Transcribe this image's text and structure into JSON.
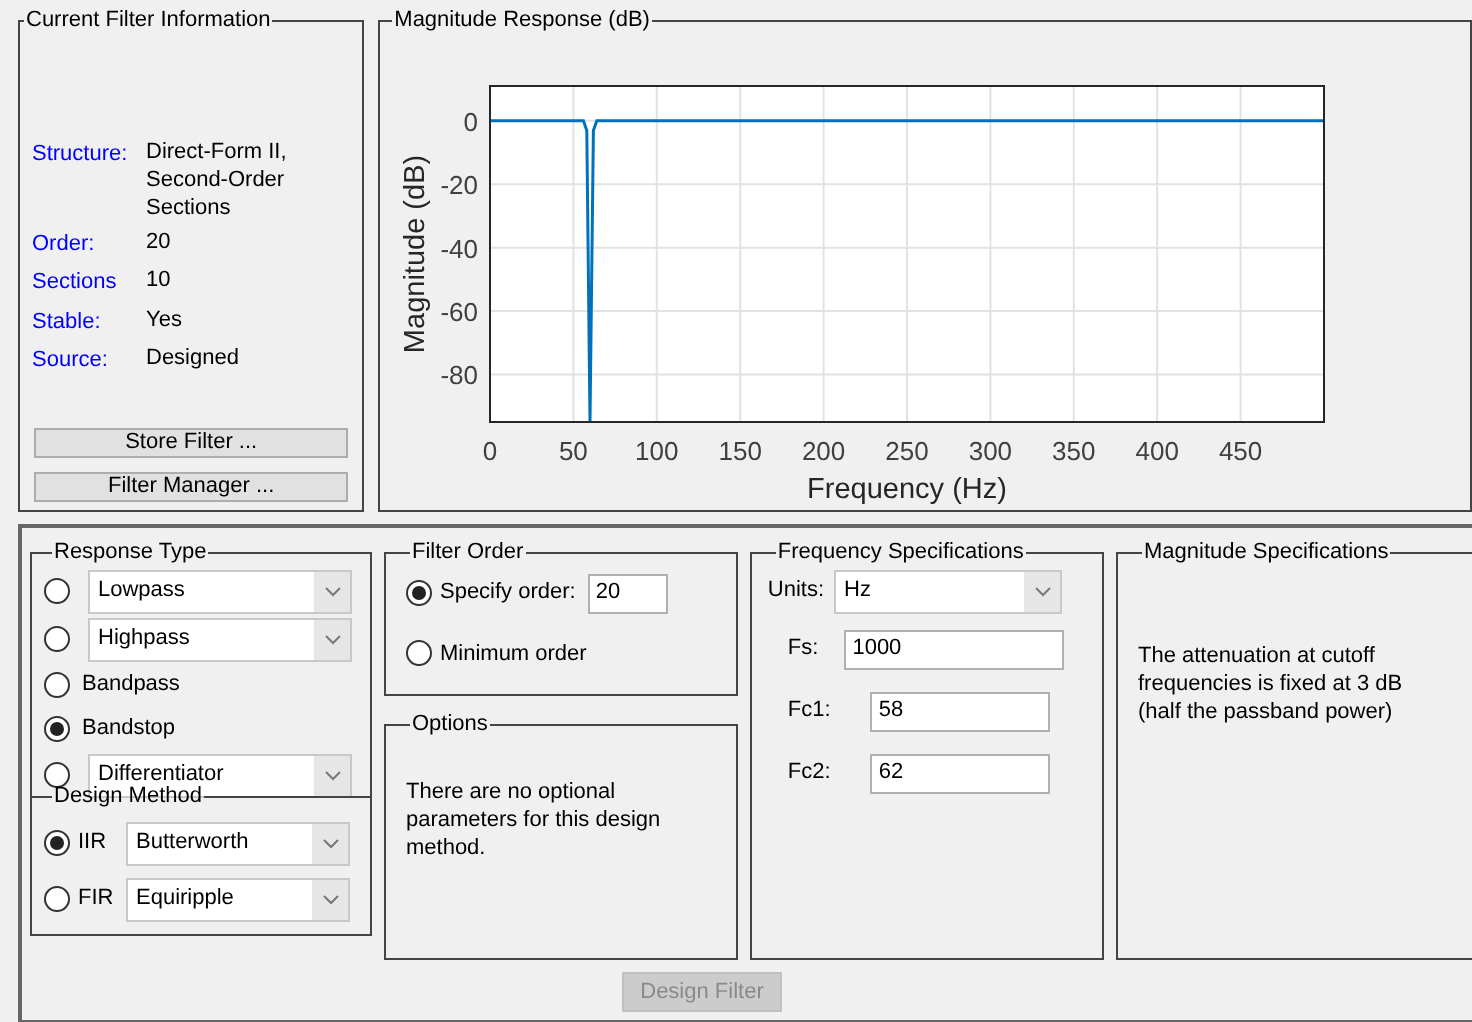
{
  "filter_info": {
    "title": "Current Filter Information",
    "rows": [
      {
        "label": "Structure:",
        "value": "Direct-Form II, Second-Order Sections"
      },
      {
        "label": "Order:",
        "value": "20"
      },
      {
        "label": "Sections",
        "value": "10"
      },
      {
        "label": "Stable:",
        "value": "Yes"
      },
      {
        "label": "Source:",
        "value": "Designed"
      }
    ],
    "buttons": [
      "Store Filter ...",
      "Filter Manager ..."
    ]
  },
  "magnitude_response": {
    "title": "Magnitude Response (dB)",
    "chart_data": {
      "type": "line",
      "xlabel": "Frequency (Hz)",
      "ylabel": "Magnitude (dB)",
      "x": [
        0,
        56,
        58,
        60,
        62,
        64,
        500
      ],
      "series": [
        {
          "color": "#0072bd",
          "values": [
            0,
            0,
            -3,
            -95,
            -3,
            0,
            0
          ]
        }
      ],
      "grid": true,
      "xlim": [
        0,
        500
      ],
      "ylim": [
        -95,
        11
      ],
      "xticks": [
        0,
        50,
        100,
        150,
        200,
        250,
        300,
        350,
        400,
        450
      ],
      "yticks": [
        -80,
        -60,
        -40,
        -20,
        0
      ]
    }
  },
  "response_type": {
    "title": "Response Type",
    "options": [
      {
        "kind": "dropdown",
        "label": "Lowpass",
        "selected": false
      },
      {
        "kind": "dropdown",
        "label": "Highpass",
        "selected": false
      },
      {
        "kind": "radio",
        "label": "Bandpass",
        "selected": false
      },
      {
        "kind": "radio",
        "label": "Bandstop",
        "selected": true
      },
      {
        "kind": "dropdown",
        "label": "Differentiator",
        "selected": false
      }
    ]
  },
  "design_method": {
    "title": "Design Method",
    "options": [
      {
        "label": "IIR",
        "value": "Butterworth",
        "selected": true
      },
      {
        "label": "FIR",
        "value": "Equiripple",
        "selected": false
      }
    ]
  },
  "filter_order": {
    "title": "Filter Order",
    "options": [
      {
        "label": "Specify order:",
        "value": "20",
        "selected": true
      },
      {
        "label": "Minimum order",
        "selected": false
      }
    ]
  },
  "options": {
    "title": "Options",
    "text": "There are no optional parameters for this design method."
  },
  "frequency_specifications": {
    "title": "Frequency Specifications",
    "units": {
      "label": "Units:",
      "value": "Hz"
    },
    "fields": [
      {
        "label": "Fs:",
        "value": "1000"
      },
      {
        "label": "Fc1:",
        "value": "58"
      },
      {
        "label": "Fc2:",
        "value": "62"
      }
    ]
  },
  "magnitude_specifications": {
    "title": "Magnitude Specifications",
    "text": "The attenuation at cutoff frequencies is fixed at 3 dB (half the passband power)"
  },
  "design_button": {
    "label": "Design Filter",
    "disabled": true
  }
}
